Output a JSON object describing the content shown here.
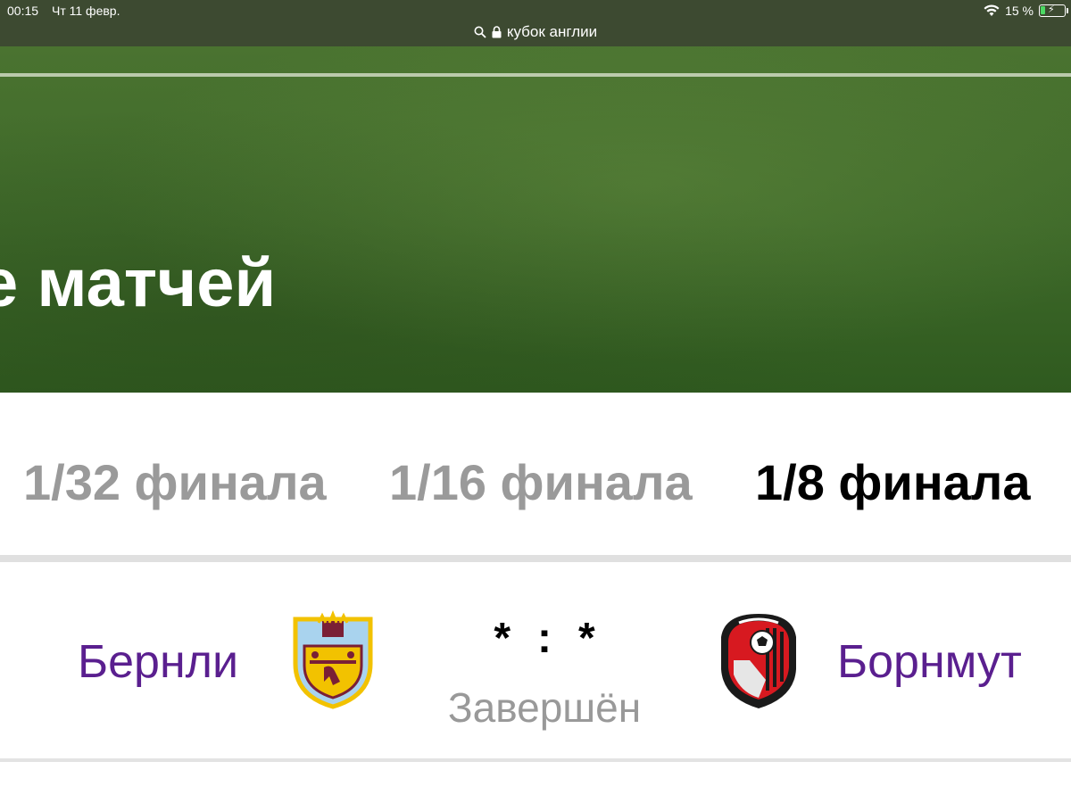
{
  "status_bar": {
    "time": "00:15",
    "date": "Чт 11 февр.",
    "battery": "15 %"
  },
  "url_bar": {
    "text": "кубок англии"
  },
  "hero": {
    "title": "е матчей"
  },
  "tabs": [
    {
      "label": "1/32 финала",
      "active": false
    },
    {
      "label": "1/16 финала",
      "active": false
    },
    {
      "label": "1/8 финала",
      "active": true
    }
  ],
  "match": {
    "home_team": "Бернли",
    "away_team": "Борнмут",
    "home_score": "*",
    "separator": ":",
    "away_score": "*",
    "status": "Завершён",
    "home_logo": "burnley-crest",
    "away_logo": "bournemouth-crest"
  },
  "colors": {
    "team_name": "#5a1f8f",
    "tab_inactive": "#9a9a9a",
    "tab_active": "#000000",
    "status_bar_bg": "#3d4a31"
  }
}
